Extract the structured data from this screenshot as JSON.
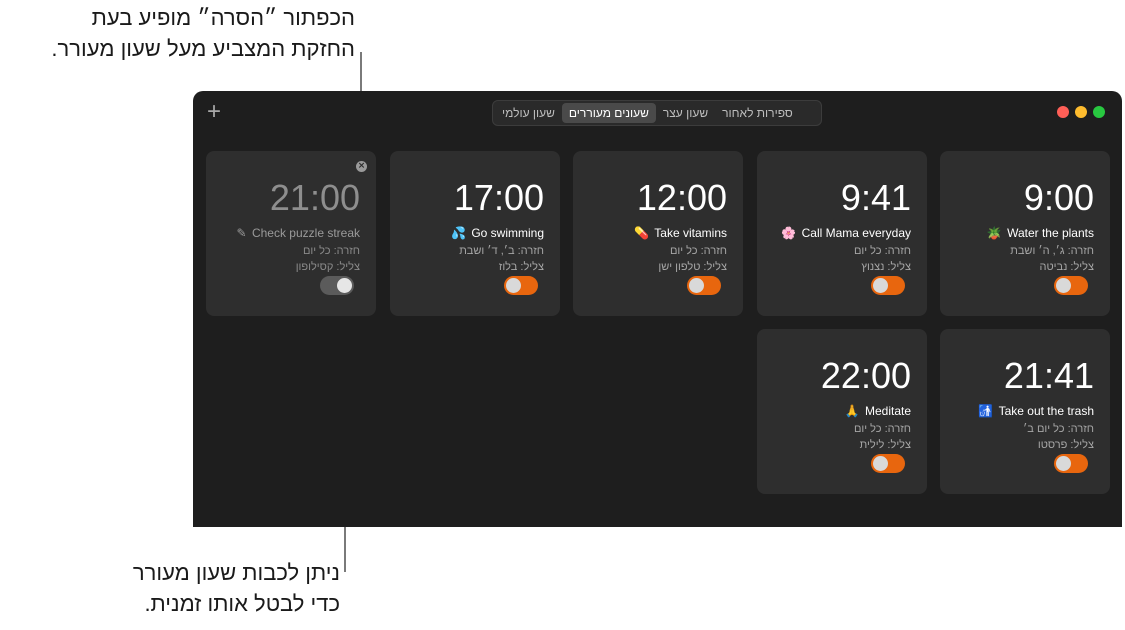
{
  "annotations": {
    "top_line1": "הכפתור ״הסרה״ מופיע בעת",
    "top_line2": "החזקת המצביע מעל שעון מעורר.",
    "bottom_line1": "ניתן לכבות שעון מעורר",
    "bottom_line2": "כדי לבטל אותו זמנית."
  },
  "window": {
    "add_icon": "+",
    "tabs": [
      {
        "label": "שעון עולמי",
        "active": false
      },
      {
        "label": "שעונים מעוררים",
        "active": true
      },
      {
        "label": "שעון עצר",
        "active": false
      },
      {
        "label": "ספירות לאחור",
        "active": false
      }
    ],
    "traffic_colors": {
      "close": "#ff5f57",
      "minimize": "#febc2e",
      "zoom": "#28c840"
    }
  },
  "alarms": [
    {
      "time": "9:00",
      "label": "Water the plants",
      "emoji": "🪴",
      "repeat": "חזרה: ג׳, ה׳ ושבת",
      "sound": "צליל: נביטה",
      "enabled": true
    },
    {
      "time": "9:41",
      "label": "Call Mama everyday",
      "emoji": "🌸",
      "repeat": "חזרה: כל יום",
      "sound": "צליל: נצנוץ",
      "enabled": true
    },
    {
      "time": "12:00",
      "label": "Take vitamins",
      "emoji": "💊",
      "repeat": "חזרה: כל יום",
      "sound": "צליל: טלפון ישן",
      "enabled": true
    },
    {
      "time": "17:00",
      "label": "Go swimming",
      "emoji": "💦",
      "repeat": "חזרה: ב׳, ד׳ ושבת",
      "sound": "צליל: בלוז",
      "enabled": true
    },
    {
      "time": "21:00",
      "label": "Check puzzle streak",
      "emoji": "✎",
      "repeat": "חזרה: כל יום",
      "sound": "צליל: קסילופון",
      "enabled": false,
      "remove_icon": "×"
    },
    {
      "time": "21:41",
      "label": "Take out the trash",
      "emoji": "🚮",
      "repeat": "חזרה: כל יום ב׳",
      "sound": "צליל: פרסטו",
      "enabled": true
    },
    {
      "time": "22:00",
      "label": "Meditate",
      "emoji": "🙏",
      "repeat": "חזרה: כל יום",
      "sound": "צליל: לילית",
      "enabled": true
    }
  ],
  "colors": {
    "accent": "#e8660e",
    "card_bg": "#2e2e2e",
    "window_bg": "#1e1e1e"
  }
}
